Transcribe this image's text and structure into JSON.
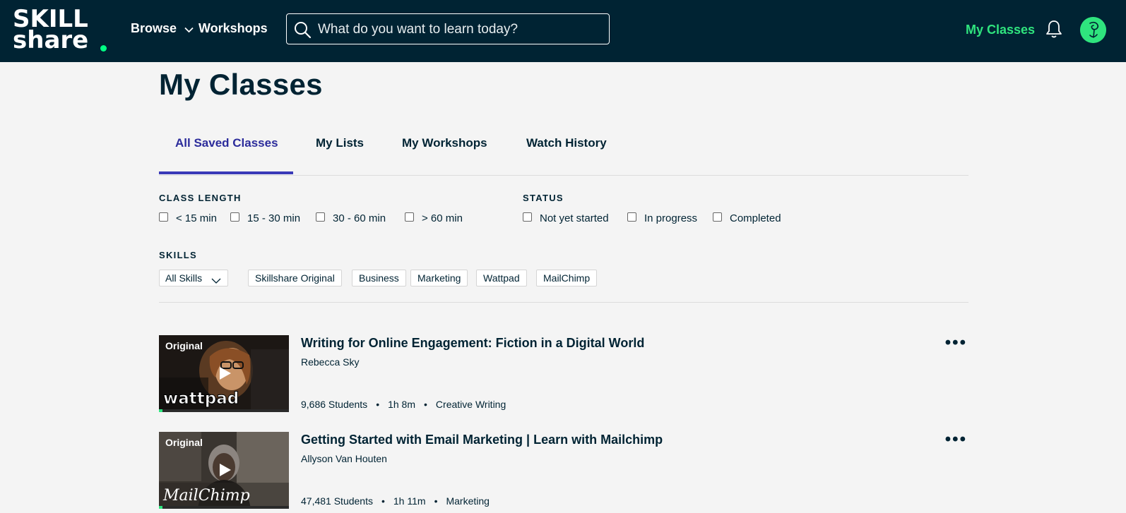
{
  "header": {
    "logo_line1": "SKILL",
    "logo_line2": "share",
    "browse_label": "Browse",
    "workshops_label": "Workshops",
    "search_placeholder": "What do you want to learn today?",
    "my_classes_label": "My Classes",
    "accent_color": "#2fe47e",
    "bg_color": "#002333"
  },
  "page": {
    "title": "My Classes"
  },
  "tabs": [
    {
      "label": "All Saved Classes",
      "active": true
    },
    {
      "label": "My Lists",
      "active": false
    },
    {
      "label": "My Workshops",
      "active": false
    },
    {
      "label": "Watch History",
      "active": false
    }
  ],
  "filters": {
    "class_length": {
      "heading": "CLASS LENGTH",
      "options": [
        "< 15 min",
        "15 - 30 min",
        "30 - 60 min",
        "> 60 min"
      ]
    },
    "status": {
      "heading": "STATUS",
      "options": [
        "Not yet started",
        "In progress",
        "Completed"
      ]
    },
    "skills": {
      "heading": "SKILLS",
      "selected": "All Skills",
      "chips": [
        "Skillshare Original",
        "Business",
        "Marketing",
        "Wattpad",
        "MailChimp"
      ]
    }
  },
  "classes": [
    {
      "badge": "Original",
      "brand": "wattpad",
      "title": "Writing for Online Engagement: Fiction in a Digital World",
      "teacher": "Rebecca Sky",
      "students": "9,686 Students",
      "duration": "1h 8m",
      "category": "Creative Writing",
      "progress": 0.03
    },
    {
      "badge": "Original",
      "brand": "MailChimp",
      "title": "Getting Started with Email Marketing | Learn with Mailchimp",
      "teacher": "Allyson Van Houten",
      "students": "47,481 Students",
      "duration": "1h 11m",
      "category": "Marketing",
      "progress": 0.03
    }
  ]
}
